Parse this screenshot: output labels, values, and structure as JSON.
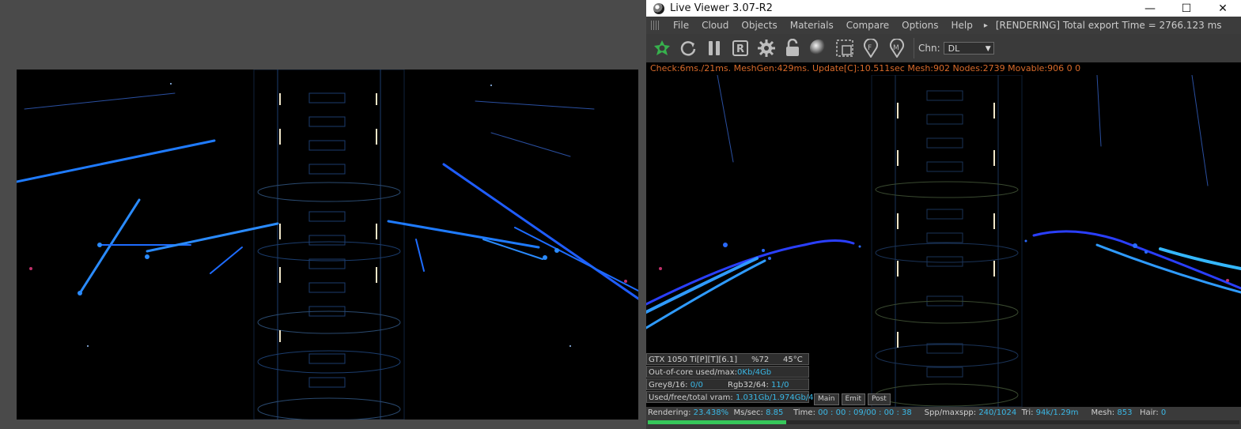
{
  "window": {
    "title": "Live Viewer 3.07-R2",
    "controls": [
      "—",
      "☐",
      "✕"
    ]
  },
  "menu": {
    "items": [
      "File",
      "Cloud",
      "Objects",
      "Materials",
      "Compare",
      "Options",
      "Help"
    ],
    "arrow": "▸",
    "render_status": "[RENDERING] Total export Time = 2766.123 ms"
  },
  "toolbar": {
    "icons": [
      "octane-logo-icon",
      "refresh-icon",
      "pause-icon",
      "r-icon",
      "gear-icon",
      "lock-icon",
      "sphere-icon",
      "region-icon",
      "pin-f-icon",
      "pin-m-icon"
    ],
    "channel_label": "Chn:",
    "channel_value": "DL"
  },
  "stats_line": "Check:6ms./21ms. MeshGen:429ms. Update[C]:10.511sec Mesh:902 Nodes:2739 Movable:906  0 0",
  "hud": {
    "gpu": "GTX 1050 Ti[P][T][6.1]",
    "gpu_usage": "%72",
    "gpu_temp": "45°C",
    "out_of_core_label": "Out-of-core used/max:",
    "out_of_core_value": "0Kb/4Gb",
    "grey_label": "Grey8/16: ",
    "grey_value": "0/0",
    "rgb_label": "Rgb32/64: ",
    "rgb_value": "11/0",
    "vram_label": "Used/free/total vram: ",
    "vram_value": "1.031Gb/1.974Gb/4Gb",
    "buttons": [
      "Main",
      "Emit",
      "Post"
    ]
  },
  "status": {
    "rendering_label": "Rendering: ",
    "rendering_value": "23.438%",
    "mssec_label": "Ms/sec: ",
    "mssec_value": "8.85",
    "time_label": "Time: ",
    "time_value": "00 : 00 : 09/00 : 00 : 38",
    "spp_label": "Spp/maxspp: ",
    "spp_value": "240/1024",
    "tri_label": "Tri: ",
    "tri_value": "94k/1.29m",
    "mesh_label": "Mesh: ",
    "mesh_value": "853",
    "hair_label": "Hair: ",
    "hair_value": "0",
    "progress": 0.2344
  },
  "colors": {
    "accent_green": "#36c75a",
    "stats_orange": "#d86a2a",
    "value_cyan": "#3ab8e6",
    "streak_blue": "#1e6cff"
  }
}
